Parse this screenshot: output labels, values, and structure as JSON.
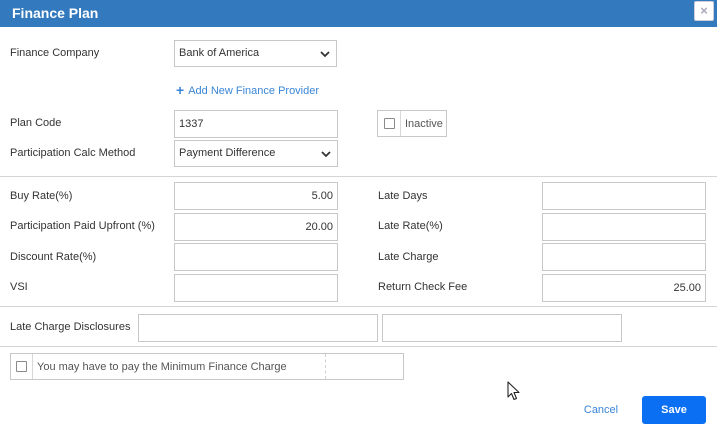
{
  "dialog": {
    "title": "Finance Plan",
    "close_glyph": "×"
  },
  "fields": {
    "finance_company": {
      "label": "Finance Company",
      "value": "Bank of America"
    },
    "add_provider": {
      "label": "Add New Finance Provider",
      "icon": "plus-icon"
    },
    "plan_code": {
      "label": "Plan Code",
      "value": "1337"
    },
    "inactive": {
      "label": "Inactive",
      "checked": false
    },
    "participation_calc": {
      "label": "Participation Calc Method",
      "value": "Payment Difference"
    },
    "buy_rate": {
      "label": "Buy Rate(%)",
      "value": "5.00"
    },
    "participation_paid_upfront": {
      "label": "Participation Paid Upfront (%)",
      "value": "20.00"
    },
    "discount_rate": {
      "label": "Discount Rate(%)",
      "value": ""
    },
    "vsi": {
      "label": "VSI",
      "value": ""
    },
    "late_days": {
      "label": "Late Days",
      "value": ""
    },
    "late_rate": {
      "label": "Late Rate(%)",
      "value": ""
    },
    "late_charge": {
      "label": "Late Charge",
      "value": ""
    },
    "return_check_fee": {
      "label": "Return Check Fee",
      "value": "25.00"
    },
    "late_charge_disclosures": {
      "label": "Late Charge Disclosures",
      "value1": "",
      "value2": ""
    },
    "minimum_finance_charge": {
      "label": "You may have to pay the Minimum Finance Charge",
      "checked": false,
      "value": ""
    }
  },
  "actions": {
    "cancel": "Cancel",
    "save": "Save"
  },
  "colors": {
    "titlebar": "#3279bd",
    "link": "#3a86d6",
    "primary": "#0a6ff2"
  }
}
